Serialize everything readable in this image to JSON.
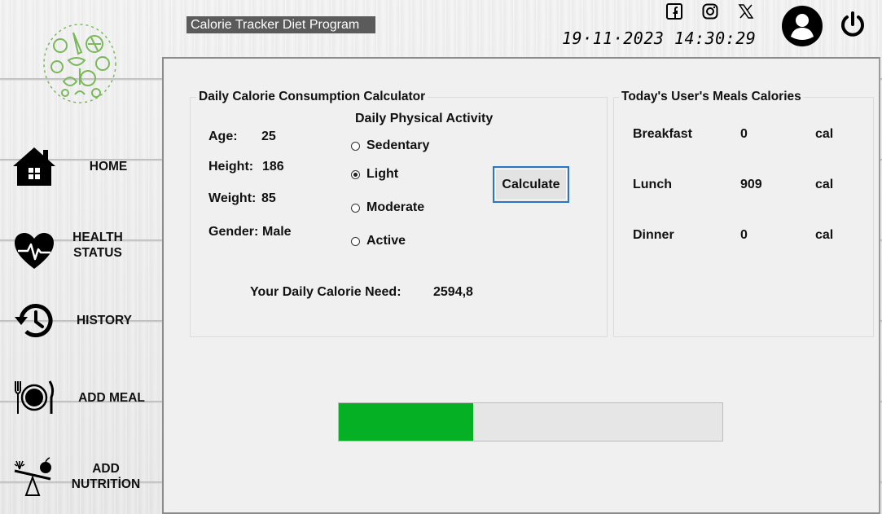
{
  "app": {
    "title": "Calorie Tracker Diet Program"
  },
  "header": {
    "datetime": "19·11·2023 14:30:29"
  },
  "social": [
    "facebook-icon",
    "instagram-icon",
    "x-icon"
  ],
  "sidebar": {
    "items": [
      {
        "label_lines": [
          "HOME"
        ],
        "icon": "house-icon"
      },
      {
        "label_lines": [
          "HEALTH",
          "STATUS"
        ],
        "icon": "heart-pulse-icon"
      },
      {
        "label_lines": [
          "HISTORY"
        ],
        "icon": "history-icon"
      },
      {
        "label_lines": [
          "ADD MEAL"
        ],
        "icon": "plate-icon"
      },
      {
        "label_lines": [
          "ADD",
          "NUTRITİON"
        ],
        "icon": "balance-scale-icon"
      }
    ]
  },
  "calculator": {
    "title": "Daily Calorie Consumption Calculator",
    "age_label": "Age:",
    "age_value": "25",
    "height_label": "Height:",
    "height_value": "186",
    "weight_label": "Weight:",
    "weight_value": "85",
    "gender_label": "Gender:",
    "gender_value": "Male",
    "activity_title": "Daily Physical Activity",
    "activities": [
      {
        "label": "Sedentary",
        "selected": false
      },
      {
        "label": "Light",
        "selected": true
      },
      {
        "label": "Moderate",
        "selected": false
      },
      {
        "label": "Active",
        "selected": false
      }
    ],
    "calculate_label": "Calculate",
    "need_label": "Your Daily Calorie Need:",
    "need_value": "2594,8"
  },
  "meals": {
    "title": "Today's User's Meals Calories",
    "rows": [
      {
        "name": "Breakfast",
        "value": "0",
        "unit": "cal"
      },
      {
        "name": "Lunch",
        "value": "909",
        "unit": "cal"
      },
      {
        "name": "Dinner",
        "value": "0",
        "unit": "cal"
      }
    ]
  },
  "progress": {
    "fraction": 0.35,
    "color": "#06b025"
  },
  "colors": {
    "button_border": "#2a78c5",
    "logo_green": "#7ab85a"
  }
}
